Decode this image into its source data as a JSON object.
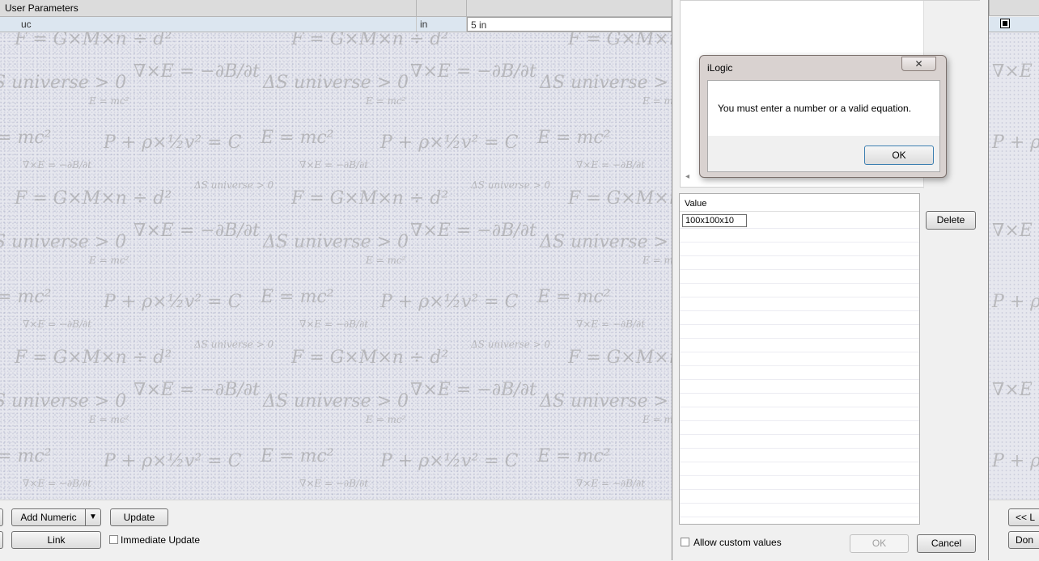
{
  "param_grid": {
    "group_label": "User Parameters",
    "row": {
      "name": "uc",
      "unit": "in",
      "equation": "5 in"
    }
  },
  "wallpaper": {
    "formulas": {
      "gravity": "F = G×M×n ÷ d²",
      "curl": "∇×E = −∂B/∂t",
      "entropy": "ΔS universe > 0",
      "energy": "E = mc²",
      "bernoulli": "P + ρ×½v² = C",
      "entropy_short": "S universe > 0",
      "energy_short": "= mc²"
    }
  },
  "bottom_bar": {
    "add_numeric_label": "Add Numeric",
    "dropdown_arrow": "▼",
    "update_label": "Update",
    "link_label": "Link",
    "immediate_update_label": "Immediate Update"
  },
  "values_dialog": {
    "header": "Value",
    "current_value": "100x100x10",
    "delete_label": "Delete",
    "allow_custom_label": "Allow custom values",
    "ok_label": "OK",
    "cancel_label": "Cancel",
    "scroll_left_glyph": "◂"
  },
  "message_box": {
    "title": "iLogic",
    "close_glyph": "✕",
    "message": "You must enter a number or a valid equation.",
    "ok_label": "OK"
  },
  "right_window": {
    "button_top": "<< L",
    "button_bottom": "Don"
  }
}
